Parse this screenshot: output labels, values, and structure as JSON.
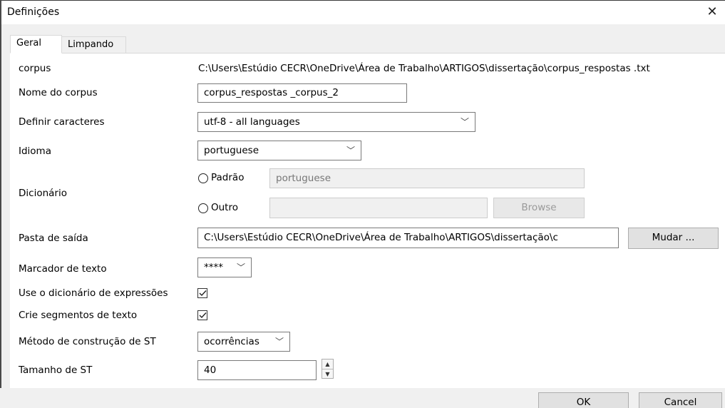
{
  "window": {
    "title": "Definições",
    "close_symbol": "✕"
  },
  "tabs": [
    {
      "label": "Geral",
      "active": true
    },
    {
      "label": "Limpando",
      "active": false
    }
  ],
  "form": {
    "corpus": {
      "label": "corpus",
      "value": "C:\\Users\\Estúdio CECR\\OneDrive\\Área de Trabalho\\ARTIGOS\\dissertação\\corpus_respostas .txt"
    },
    "nome_corpus": {
      "label": "Nome do corpus",
      "value": "corpus_respostas _corpus_2"
    },
    "caracteres": {
      "label": "Definir caracteres",
      "value": "utf-8 - all languages"
    },
    "idioma": {
      "label": "Idioma",
      "value": "portuguese"
    },
    "dicionario": {
      "label": "Dicionário",
      "padrao_label": "Padrão",
      "padrao_value": "portuguese",
      "outro_label": "Outro",
      "outro_value": "",
      "browse_label": "Browse"
    },
    "pasta_saida": {
      "label": "Pasta de saída",
      "value": "C:\\Users\\Estúdio CECR\\OneDrive\\Área de Trabalho\\ARTIGOS\\dissertação\\c",
      "button_label": "Mudar ..."
    },
    "marcador": {
      "label": "Marcador de texto",
      "value": "****"
    },
    "use_dicionario": {
      "label": "Use o dicionário de expressões",
      "checked": true
    },
    "crie_segmentos": {
      "label": "Crie segmentos de texto",
      "checked": true
    },
    "metodo_st": {
      "label": "Método de construção de ST",
      "value": "ocorrências"
    },
    "tamanho_st": {
      "label": "Tamanho de ST",
      "value": "40"
    }
  },
  "footer": {
    "ok_label": "OK",
    "cancel_label": "Cancel"
  }
}
